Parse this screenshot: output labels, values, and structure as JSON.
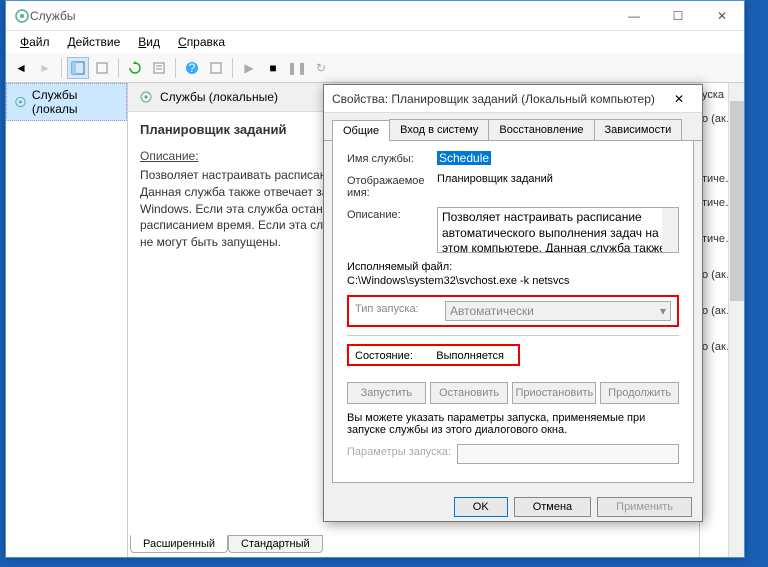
{
  "window": {
    "title": "Службы",
    "menu": {
      "file": "Файл",
      "action": "Действие",
      "view": "Вид",
      "help": "Справка"
    },
    "min": "—",
    "max": "☐",
    "close": "✕"
  },
  "left": {
    "item": "Службы (локалы"
  },
  "mid": {
    "header": "Службы (локальные)",
    "service_name": "Планировщик заданий",
    "desc_label": "Описание:",
    "desc_text": "Позволяет настраивать расписание автоматического выполнения задач на этом компьютере. Данная служба также отвечает за выполнение нескольких критически важных системных задач Windows. Если эта служба остановлена, эти задачи не могут быть запущены в установленное расписанием время. Если эта служба отключена, любые службы, которые явно зависят от нее, не могут быть запущены.",
    "tab_ext": "Расширенный",
    "tab_std": "Стандартный"
  },
  "right": {
    "items": [
      "уска",
      "о (ак…",
      "",
      "",
      "",
      "тиче…",
      "тиче…",
      "",
      "тиче…",
      "",
      "о (ак…",
      "",
      "о (ак…",
      "",
      "о (ак…"
    ]
  },
  "dialog": {
    "title": "Свойства: Планировщик заданий (Локальный компьютер)",
    "close": "✕",
    "tabs": {
      "general": "Общие",
      "logon": "Вход в систему",
      "recovery": "Восстановление",
      "deps": "Зависимости"
    },
    "labels": {
      "name": "Имя службы:",
      "display": "Отображаемое имя:",
      "desc": "Описание:",
      "exe": "Исполняемый файл:",
      "startup": "Тип запуска:",
      "state": "Состояние:",
      "params_hint": "Вы можете указать параметры запуска, применяемые при запуске службы из этого диалогового окна.",
      "params": "Параметры запуска:"
    },
    "values": {
      "name": "Schedule",
      "display": "Планировщик заданий",
      "desc": "Позволяет настраивать расписание автоматического выполнения задач на этом компьютере. Данная служба также отвечает за выполнение нескольких критически важных",
      "exe": "C:\\Windows\\system32\\svchost.exe -k netsvcs",
      "startup": "Автоматически",
      "state": "Выполняется"
    },
    "svc_btns": {
      "start": "Запустить",
      "stop": "Остановить",
      "pause": "Приостановить",
      "resume": "Продолжить"
    },
    "btns": {
      "ok": "OK",
      "cancel": "Отмена",
      "apply": "Применить"
    }
  }
}
